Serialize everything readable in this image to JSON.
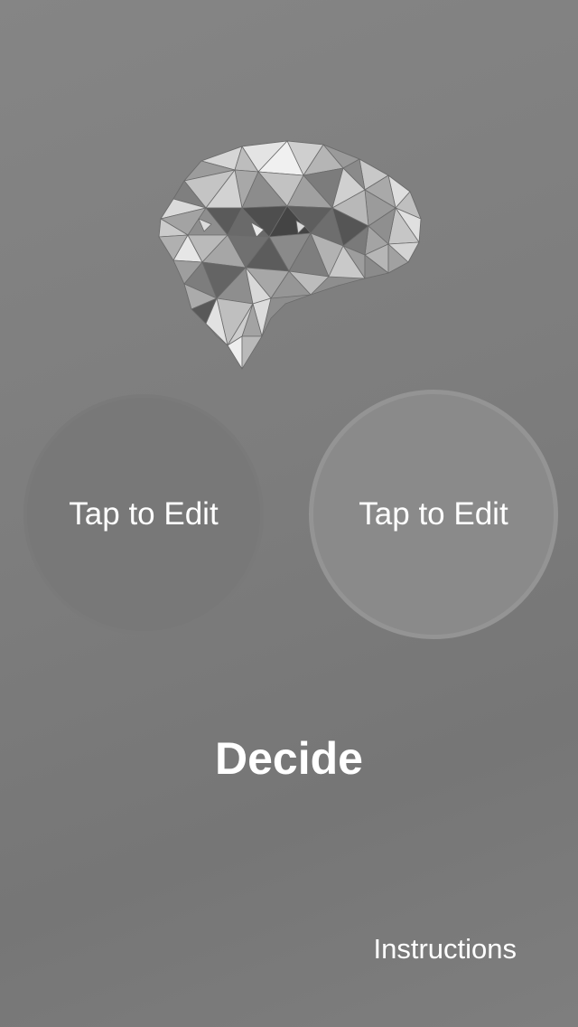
{
  "app": {
    "logo_icon": "low-poly-brain-icon"
  },
  "options": {
    "left_label": "Tap to Edit",
    "right_label": "Tap to Edit"
  },
  "actions": {
    "decide_label": "Decide",
    "instructions_label": "Instructions"
  },
  "colors": {
    "background": "#7d7d7d",
    "left_circle": "#787878",
    "right_circle": "#8a8a8a",
    "right_circle_border": "#949494",
    "text": "#ffffff"
  }
}
